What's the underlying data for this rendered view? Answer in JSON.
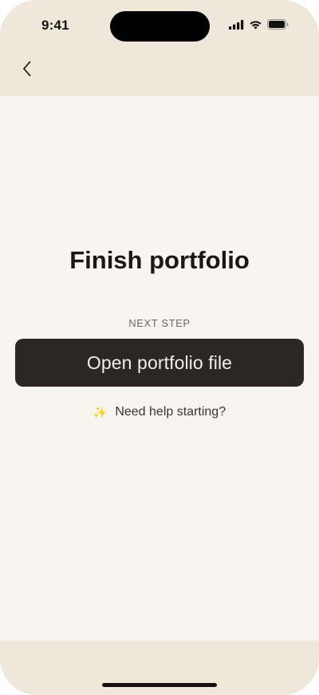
{
  "status_bar": {
    "time": "9:41",
    "icons": [
      "cellular-signal-icon",
      "wifi-icon",
      "battery-icon"
    ]
  },
  "nav": {
    "back_icon": "chevron-left-icon"
  },
  "main": {
    "title": "Finish portfolio",
    "step_label": "NEXT STEP",
    "primary_button_label": "Open portfolio file",
    "help_icon": "sparkles-icon",
    "help_text": "Need help starting?"
  },
  "colors": {
    "header_bg": "#efe8da",
    "content_bg": "#f8f5ee",
    "button_bg": "#2e2622",
    "button_text": "#f4efe6",
    "title_text": "#1a1715",
    "sparkle": "#e8b84a"
  }
}
